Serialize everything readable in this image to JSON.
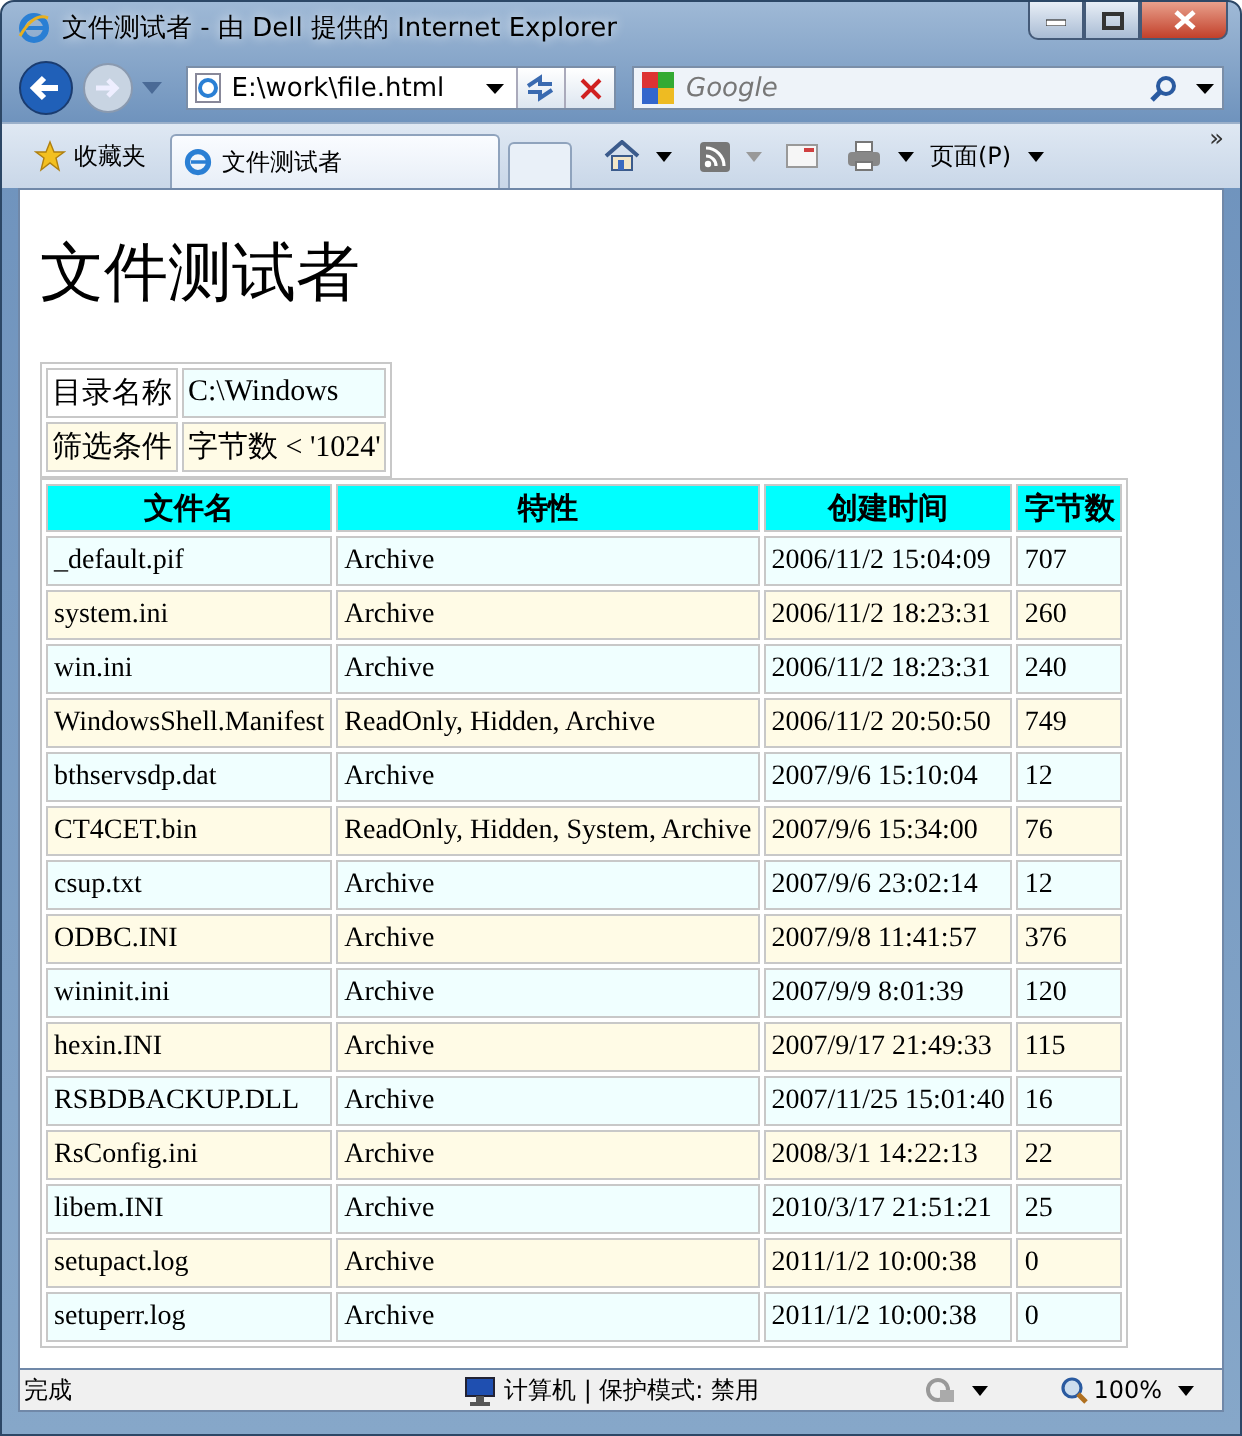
{
  "window": {
    "title": "文件测试者 - 由 Dell 提供的 Internet Explorer"
  },
  "address_bar": {
    "value": "E:\\work\\file.html"
  },
  "search": {
    "placeholder": "Google"
  },
  "favorites": {
    "label": "收藏夹"
  },
  "tabs": [
    {
      "label": "文件测试者",
      "selected": true
    }
  ],
  "toolbar": {
    "page_menu": "页面(P)",
    "overflow": "»"
  },
  "page": {
    "heading": "文件测试者",
    "info": [
      {
        "label": "目录名称",
        "value": "C:\\Windows"
      },
      {
        "label": "筛选条件",
        "value": "字节数 < '1024'"
      }
    ],
    "table": {
      "columns": [
        "文件名",
        "特性",
        "创建时间",
        "字节数"
      ],
      "rows": [
        [
          "_default.pif",
          "Archive",
          "2006/11/2 15:04:09",
          "707"
        ],
        [
          "system.ini",
          "Archive",
          "2006/11/2 18:23:31",
          "260"
        ],
        [
          "win.ini",
          "Archive",
          "2006/11/2 18:23:31",
          "240"
        ],
        [
          "WindowsShell.Manifest",
          "ReadOnly, Hidden, Archive",
          "2006/11/2 20:50:50",
          "749"
        ],
        [
          "bthservsdp.dat",
          "Archive",
          "2007/9/6 15:10:04",
          "12"
        ],
        [
          "CT4CET.bin",
          "ReadOnly, Hidden, System, Archive",
          "2007/9/6 15:34:00",
          "76"
        ],
        [
          "csup.txt",
          "Archive",
          "2007/9/6 23:02:14",
          "12"
        ],
        [
          "ODBC.INI",
          "Archive",
          "2007/9/8 11:41:57",
          "376"
        ],
        [
          "wininit.ini",
          "Archive",
          "2007/9/9 8:01:39",
          "120"
        ],
        [
          "hexin.INI",
          "Archive",
          "2007/9/17 21:49:33",
          "115"
        ],
        [
          "RSBDBACKUP.DLL",
          "Archive",
          "2007/11/25 15:01:40",
          "16"
        ],
        [
          "RsConfig.ini",
          "Archive",
          "2008/3/1 14:22:13",
          "22"
        ],
        [
          "libem.INI",
          "Archive",
          "2010/3/17 21:51:21",
          "25"
        ],
        [
          "setupact.log",
          "Archive",
          "2011/1/2 10:00:38",
          "0"
        ],
        [
          "setuperr.log",
          "Archive",
          "2011/1/2 10:00:38",
          "0"
        ]
      ]
    }
  },
  "status_bar": {
    "status": "完成",
    "zone": "计算机 | 保护模式: 禁用",
    "zoom": "100%"
  }
}
